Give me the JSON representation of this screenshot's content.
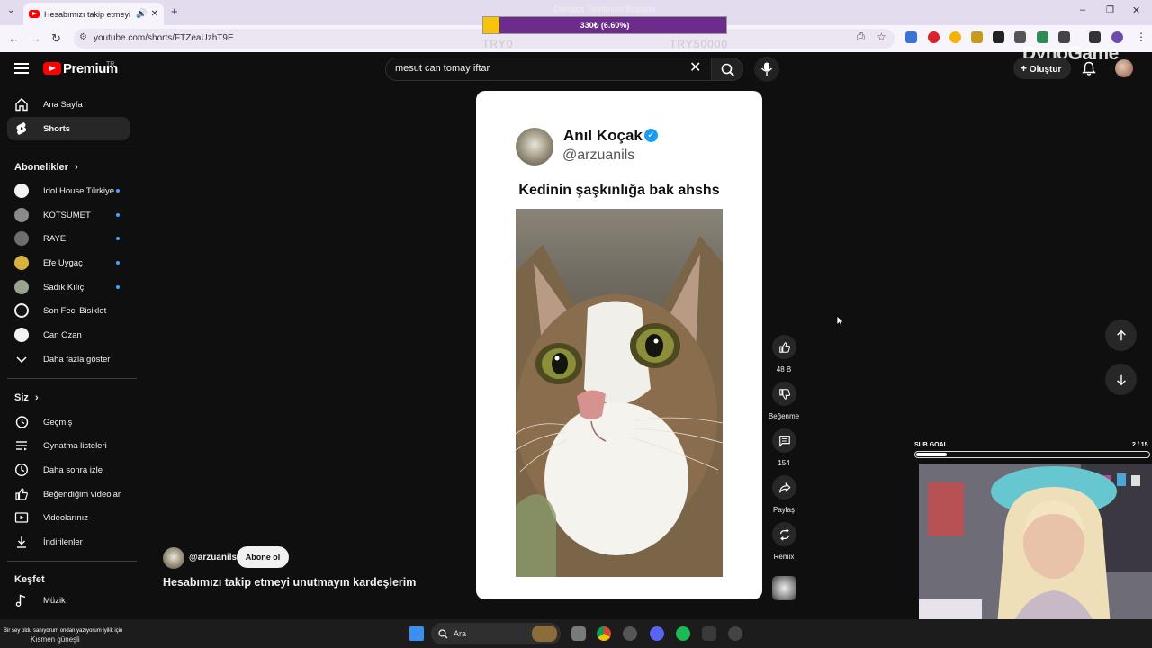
{
  "browser": {
    "tab_title": "Hesabımızı takip etmeyi unutmayın",
    "url": "youtube.com/shorts/FTZeaUzhT9E"
  },
  "overlay": {
    "goal_title": "Duruşçe Telefonum Bozuldu",
    "progress_text": "330₺ (6.60%)",
    "progress_fraction": 0.066,
    "min_label": "TRY0",
    "max_label": "TRY50000",
    "watermark": "DynoGame"
  },
  "header": {
    "brand": "Premium",
    "country": "TR",
    "search_value": "mesut can tomay iftar",
    "create_label": "Oluştur"
  },
  "sidebar": {
    "main": [
      {
        "label": "Ana Sayfa",
        "icon": "home-icon"
      },
      {
        "label": "Shorts",
        "icon": "shorts-icon"
      }
    ],
    "subs_heading": "Abonelikler",
    "subscriptions": [
      {
        "label": "Idol House Türkiye",
        "color": "#f2f2f2"
      },
      {
        "label": "KOTSUMET",
        "color": "#8a8a8a"
      },
      {
        "label": "RAYE",
        "color": "#6e6e6e"
      },
      {
        "label": "Efe Uygaç",
        "color": "#d9b23e"
      },
      {
        "label": "Sadık Kılıç",
        "color": "#9aa390"
      },
      {
        "label": "Son Feci Bisiklet",
        "color": "#eeeeee"
      },
      {
        "label": "Can Ozan",
        "color": "#f2f2f2"
      }
    ],
    "show_more": "Daha fazla göster",
    "you_heading": "Siz",
    "you_items": [
      {
        "label": "Geçmiş",
        "icon": "history-icon"
      },
      {
        "label": "Oynatma listeleri",
        "icon": "playlists-icon"
      },
      {
        "label": "Daha sonra izle",
        "icon": "clock-icon"
      },
      {
        "label": "Beğendiğim videolar",
        "icon": "thumb-up-icon"
      },
      {
        "label": "Videolarınız",
        "icon": "video-icon"
      },
      {
        "label": "İndirilenler",
        "icon": "download-icon"
      }
    ],
    "explore_heading": "Keşfet",
    "explore_items": [
      {
        "label": "Müzik",
        "icon": "music-icon"
      }
    ]
  },
  "short": {
    "tweet_name": "Anıl Koçak",
    "tweet_handle": "@arzuanils",
    "tweet_text": "Kedinin şaşkınlığa bak ahshs",
    "channel": "@arzuanils",
    "subscribe_label": "Abone ol",
    "title": "Hesabımızı takip etmeyi unutmayın kardeşlerim"
  },
  "actions": {
    "likes": "48 B",
    "dislike": "Beğenme",
    "comments": "154",
    "share": "Paylaş",
    "remix": "Remix"
  },
  "stream": {
    "sub_goal_label": "SUB GOAL",
    "sub_goal_count": "2 / 15",
    "sub_goal_fraction": 0.133
  },
  "taskbar": {
    "search_placeholder": "Ara",
    "chat_line": "Bir şey oldu sanıyorum ondan yazıyorum iyilik için",
    "weather": "Kısmen güneşli"
  }
}
